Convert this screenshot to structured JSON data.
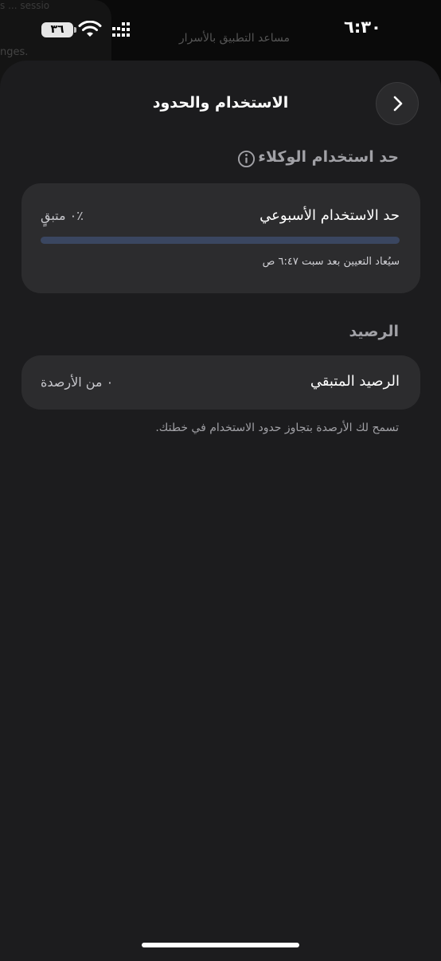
{
  "background": {
    "title": "مساعد التطبيق بالأسرار",
    "left_text": "nges.",
    "top_left_text": "s ... sessio"
  },
  "status_bar": {
    "time": "٦:٣٠",
    "battery": "٣٦"
  },
  "header": {
    "title": "الاستخدام والحدود"
  },
  "agent_limit": {
    "section_title": "حد استخدام الوكلاء",
    "weekly_limit_label": "حد الاستخدام الأسبوعي",
    "remaining": "٪٠ متبقٍ",
    "progress_fraction": 0,
    "reset_text": "سيُعاد التعيين بعد سبت ٦:٤٧ ص"
  },
  "balance": {
    "section_title": "الرصيد",
    "remaining_label": "الرصيد المتبقي",
    "remaining_value": "٠ من الأرصدة",
    "footnote": "تسمح لك الأرصدة بتجاوز حدود الاستخدام في خطتك."
  },
  "colors": {
    "sheet": "#1c1c1e",
    "card": "#2c2c2e",
    "progress_track": "#3a4660"
  }
}
